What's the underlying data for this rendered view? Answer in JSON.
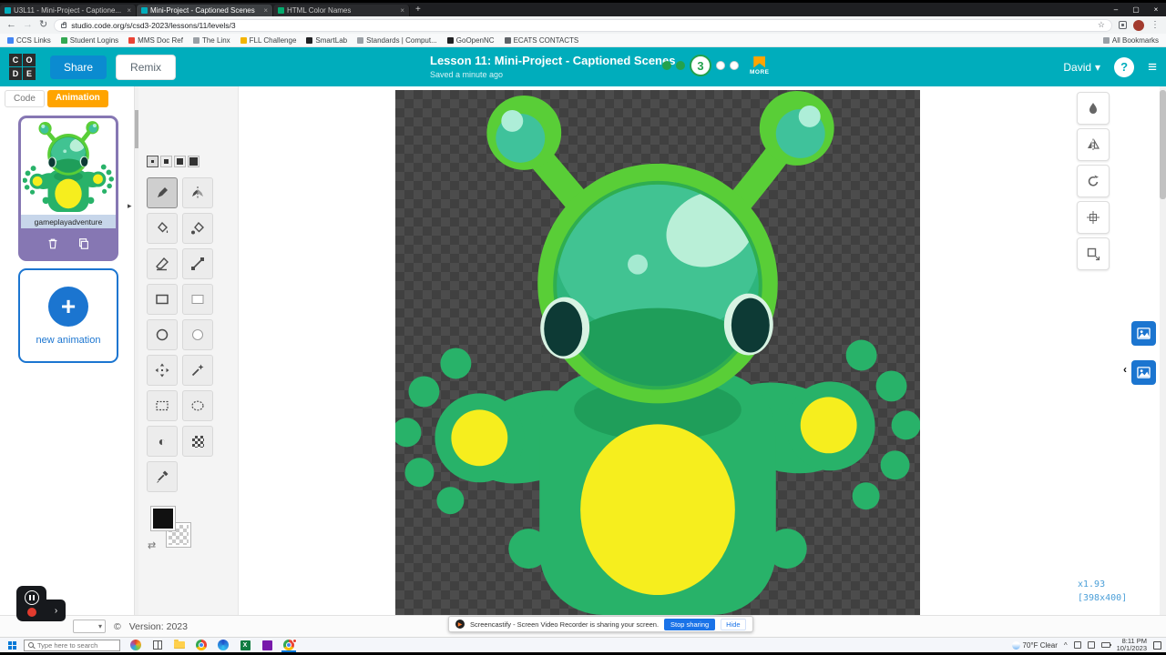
{
  "glyphs": {
    "back": "←",
    "forward": "→",
    "reload": "↻",
    "star": "☆",
    "kebab": "⋮",
    "minimize": "–",
    "maximize": "▢",
    "close": "×",
    "newtab": "+",
    "caret_down": "▾",
    "hamburger": "≡",
    "plus": "+",
    "chevron_right": "›",
    "chevron_left": "‹",
    "swap": "⇄",
    "lighten": "◐",
    "panel_arrow": "▸",
    "tray_caret": "^"
  },
  "browser": {
    "tabs": [
      {
        "label": "U3L11 - Mini-Project - Captione...",
        "favicon_color": "#00adbc",
        "active": false
      },
      {
        "label": "Mini-Project - Captioned Scenes",
        "favicon_color": "#00adbc",
        "active": true
      },
      {
        "label": "HTML Color Names",
        "favicon_color": "#04aa6d",
        "active": false
      }
    ],
    "url": "studio.code.org/s/csd3-2023/lessons/11/levels/3",
    "bookmarks": [
      {
        "label": "CCS Links",
        "color": "#4285f4"
      },
      {
        "label": "Student Logins",
        "color": "#34a853"
      },
      {
        "label": "MMS Doc Ref",
        "color": "#ea4335"
      },
      {
        "label": "The Linx",
        "color": "#9aa0a6"
      },
      {
        "label": "FLL Challenge",
        "color": "#f4b400"
      },
      {
        "label": "SmartLab",
        "color": "#202124"
      },
      {
        "label": "Standards | Comput...",
        "color": "#9aa0a6"
      },
      {
        "label": "GoOpenNC",
        "color": "#202124"
      },
      {
        "label": "ECATS CONTACTS",
        "color": "#5f6368"
      }
    ],
    "all_bookmarks_label": "All Bookmarks"
  },
  "header": {
    "logo_letters": [
      "C",
      "O",
      "D",
      "E"
    ],
    "share_label": "Share",
    "remix_label": "Remix",
    "title": "Lesson 11: Mini-Project - Captioned Scenes",
    "saved_label": "Saved a minute ago",
    "level_number": "3",
    "more_label": "MORE",
    "user_name": "David",
    "help_label": "?"
  },
  "panel": {
    "code_tab": "Code",
    "animation_tab": "Animation",
    "animation_name": "gameplayadventure",
    "new_animation_label": "new animation"
  },
  "tools": {
    "selected": "pen",
    "items": [
      "pen",
      "vertical-mirror-pen",
      "paint-bucket",
      "colorswap-bucket",
      "eraser",
      "stroke",
      "rectangle",
      "filled-rectangle",
      "circle",
      "filled-circle",
      "move",
      "magic-wand-select",
      "rect-select",
      "lasso-select",
      "lighten",
      "dithering",
      "colorpicker"
    ]
  },
  "transform_tools": [
    "invert-colors",
    "flip",
    "rotate",
    "align-center",
    "crop-resize"
  ],
  "canvas": {
    "zoom_label": "x1.93",
    "size_label": "[398x400]"
  },
  "footer": {
    "version_label": "Version: 2023",
    "copyright_label": "©"
  },
  "screencastify": {
    "message": "Screencastify - Screen Video Recorder is sharing your screen.",
    "stop_label": "Stop sharing",
    "hide_label": "Hide"
  },
  "taskbar": {
    "search_placeholder": "Type here to search",
    "weather_label": "70°F Clear",
    "time_label": "8:11 PM",
    "date_label": "10/1/2023"
  }
}
